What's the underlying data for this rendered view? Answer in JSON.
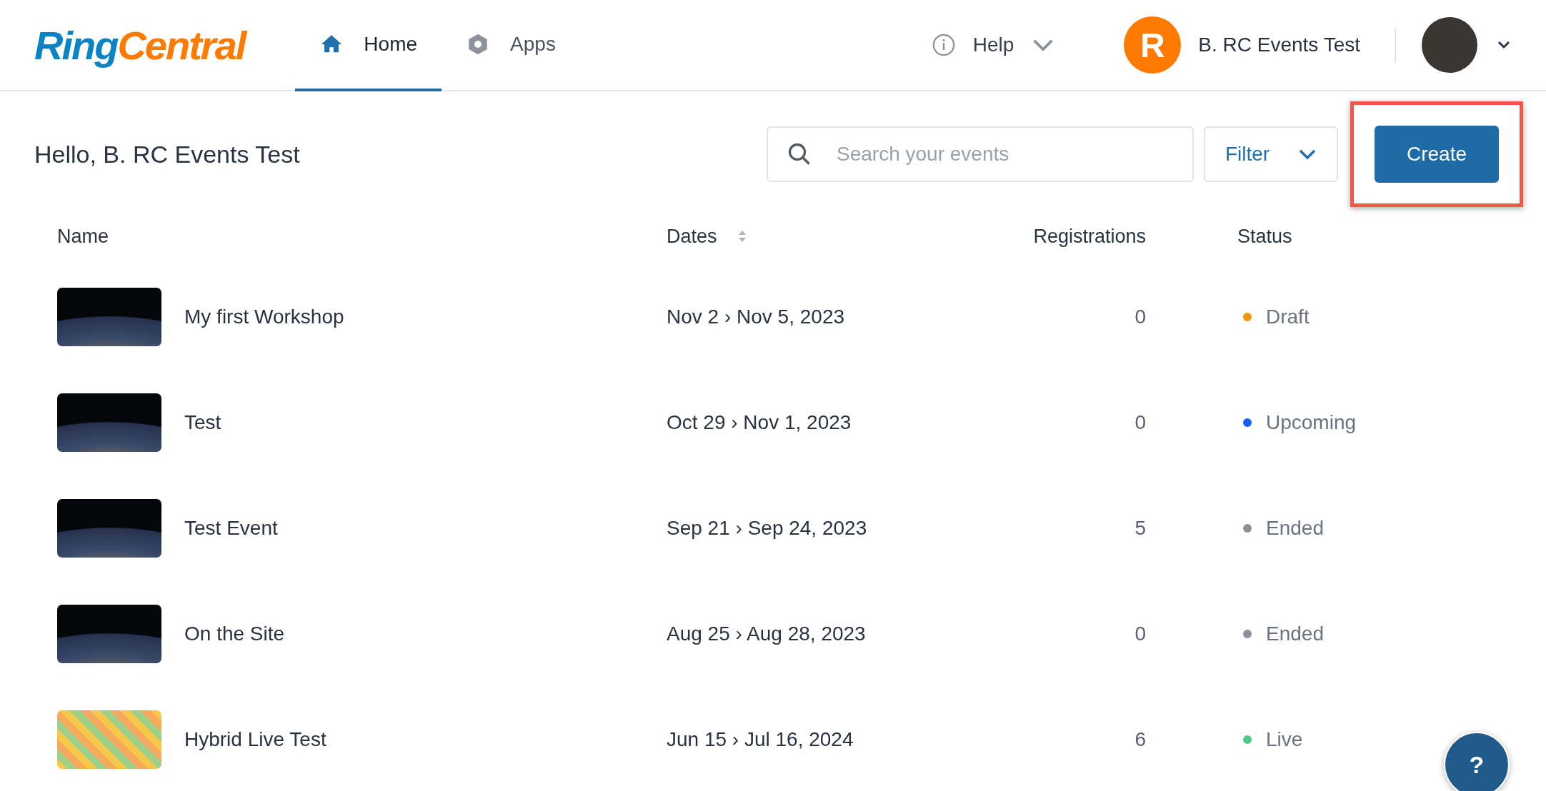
{
  "header": {
    "logo": {
      "part_1": "Ring",
      "part_2": "Central"
    },
    "nav_tabs": [
      {
        "label": "Home",
        "kind": "home",
        "selected": true
      },
      {
        "label": "Apps",
        "kind": "apps",
        "selected": false
      }
    ],
    "help": "Help",
    "account": {
      "initial": "R",
      "name": "B. RC Events Test"
    }
  },
  "greeting": "Hello, B. RC Events Test",
  "search": {
    "placeholder": "Search your events"
  },
  "filter_button": "Filter",
  "create_button": {
    "label": "Create",
    "highlighted": true
  },
  "table": {
    "columns": [
      {
        "label": "Name",
        "sortable": false
      },
      {
        "label": "Dates",
        "sortable": true
      },
      {
        "label": "Registrations",
        "sortable": false
      },
      {
        "label": "Status",
        "sortable": false
      }
    ],
    "rows": [
      {
        "kind": "photo",
        "name": "My first Workshop",
        "dates": "Nov 2 › Nov 5, 2023",
        "registrations": "0",
        "status": "Draft",
        "color": "#f0960f"
      },
      {
        "kind": "photo",
        "name": "Test",
        "dates": "Oct 29 › Nov 1, 2023",
        "registrations": "0",
        "status": "Upcoming",
        "color": "#1a5cff"
      },
      {
        "kind": "photo",
        "name": "Test Event",
        "dates": "Sep 21 › Sep 24, 2023",
        "registrations": "5",
        "status": "Ended",
        "color": "#8c909c"
      },
      {
        "kind": "photo",
        "name": "On the Site",
        "dates": "Aug 25 › Aug 28, 2023",
        "registrations": "0",
        "status": "Ended",
        "color": "#8c909c"
      },
      {
        "kind": "pattern",
        "name": "Hybrid Live Test",
        "dates": "Jun 15 › Jul 16, 2024",
        "registrations": "6",
        "status": "Live",
        "color": "#4fc98a"
      }
    ]
  },
  "help_fab": "?"
}
